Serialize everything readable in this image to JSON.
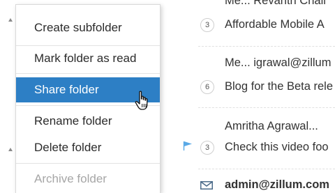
{
  "menu": {
    "items": [
      {
        "label": "Create subfolder",
        "state": "normal"
      },
      {
        "label": "Mark folder as read",
        "state": "normal"
      },
      {
        "label": "Share folder",
        "state": "active"
      },
      {
        "label": "Rename folder",
        "state": "normal"
      },
      {
        "label": "Delete folder",
        "state": "normal"
      },
      {
        "label": "Archive folder",
        "state": "disabled"
      }
    ],
    "active_color": "#2d7fc5"
  },
  "messages": [
    {
      "sender": "Me... Revanth Chall",
      "count": "3",
      "subject": "Affordable Mobile A"
    },
    {
      "sender": "Me... igrawal@zillum",
      "count": "6",
      "subject": "Blog for the Beta rele"
    },
    {
      "sender": "Amritha Agrawal...",
      "count": "3",
      "subject": "Check this video foo",
      "flagged": true
    },
    {
      "sender": "admin@zillum.com",
      "unread": true,
      "icon": "envelope-icon"
    }
  ],
  "colors": {
    "flag": "#5aa9e6",
    "envelope": "#4b6b8a"
  }
}
